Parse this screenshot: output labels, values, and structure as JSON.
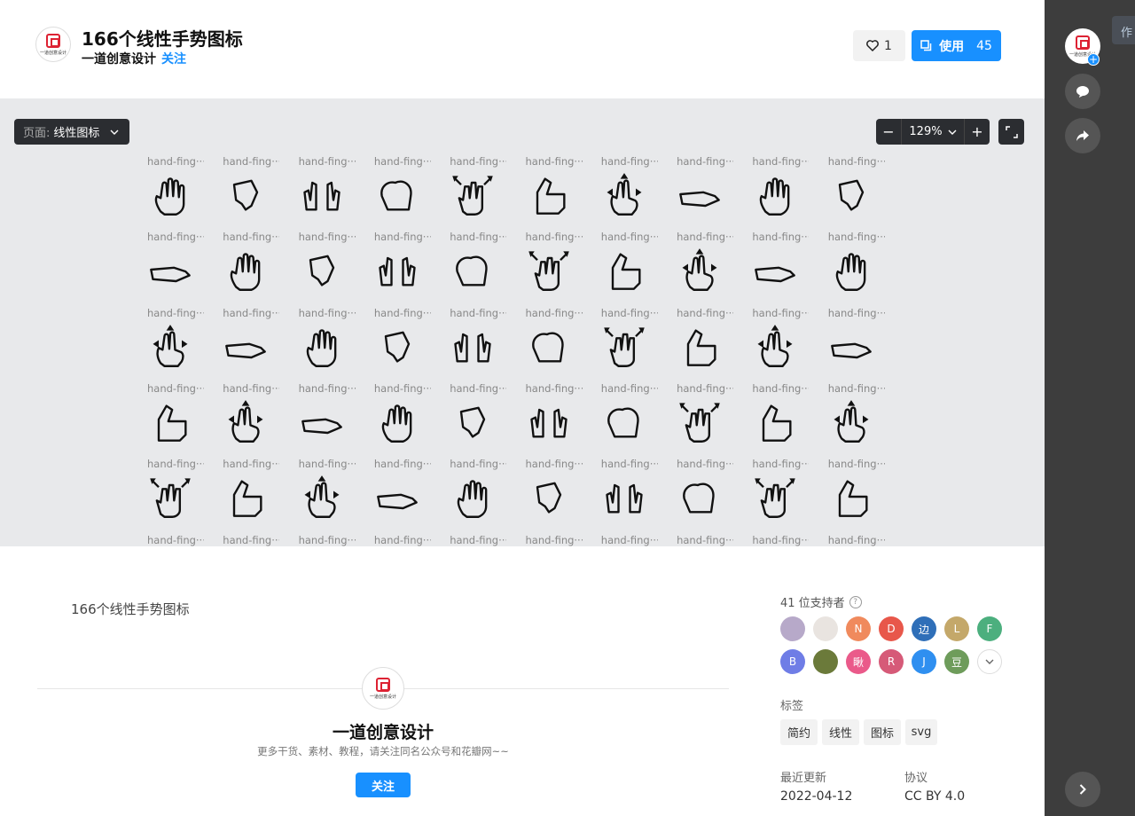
{
  "header": {
    "title": "166个线性手势图标",
    "author": "一道创意设计",
    "follow_label": "关注",
    "like_count": "1",
    "use_label": "使用",
    "use_count": "45"
  },
  "logo_text": "一道创意设计",
  "toolbar": {
    "page_label": "页面:",
    "page_value": "线性图标",
    "zoom_level": "129%",
    "zoom_out": "−",
    "zoom_in": "+"
  },
  "icons": {
    "caption": "hand-fing···",
    "row_count": 6,
    "col_count": 10
  },
  "description": "166个线性手势图标",
  "profile": {
    "name": "一道创意设计",
    "subtitle": "更多干货、素材、教程，请关注同名公众号和花瓣网~~",
    "follow_label": "关注"
  },
  "supporters": {
    "label": "41 位支持者",
    "help": "?",
    "avatars": [
      {
        "text": "",
        "color": "#b7a9c9"
      },
      {
        "text": "",
        "color": "#e9e4e0"
      },
      {
        "text": "N",
        "color": "#f08a5d"
      },
      {
        "text": "D",
        "color": "#e8574a"
      },
      {
        "text": "边",
        "color": "#2f6fb8"
      },
      {
        "text": "L",
        "color": "#c4a86a"
      },
      {
        "text": "F",
        "color": "#4caf7e"
      },
      {
        "text": "B",
        "color": "#6f7de6"
      },
      {
        "text": "",
        "color": "#6b7a3a"
      },
      {
        "text": "瞅",
        "color": "#ea5a8a"
      },
      {
        "text": "R",
        "color": "#d65a78"
      },
      {
        "text": "J",
        "color": "#2f8ff0"
      },
      {
        "text": "豆",
        "color": "#6e9c5b"
      }
    ]
  },
  "tags": {
    "label": "标签",
    "items": [
      "简约",
      "线性",
      "图标",
      "svg"
    ]
  },
  "meta": {
    "updated_label": "最近更新",
    "updated_value": "2022-04-12",
    "license_label": "协议",
    "license_value": "CC BY 4.0"
  },
  "sidebar": {
    "tab_label": "作"
  }
}
